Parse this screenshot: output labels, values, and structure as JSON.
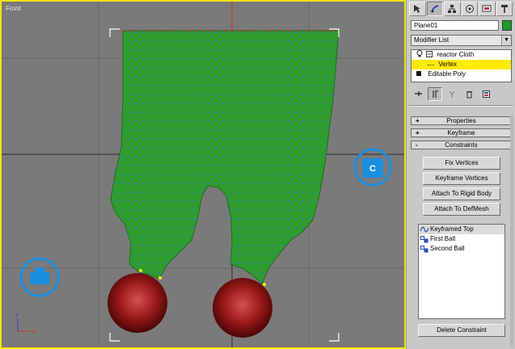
{
  "viewport": {
    "label": "Front",
    "helper_left_label": "",
    "helper_right_label": "C",
    "axis_x_label": "x",
    "axis_z_label": "z"
  },
  "panel": {
    "tabs": [
      {
        "name": "create-tab",
        "icon": "cursor-icon"
      },
      {
        "name": "modify-tab",
        "icon": "modify-icon"
      },
      {
        "name": "hierarchy-tab",
        "icon": "hierarchy-icon"
      },
      {
        "name": "motion-tab",
        "icon": "motion-icon"
      },
      {
        "name": "display-tab",
        "icon": "display-icon"
      },
      {
        "name": "utilities-tab",
        "icon": "hammer-icon"
      }
    ],
    "object_name": "Plane01",
    "object_color": "#1e9a2a",
    "modifier_list_label": "Modifier List",
    "stack": [
      {
        "label": "reactor Cloth",
        "icon": "bulb-icon",
        "expand": "minus"
      },
      {
        "label": "Vertex",
        "selected": true
      },
      {
        "label": "Editable Poly",
        "icon": "black-square-icon"
      }
    ],
    "rollouts": [
      {
        "sign": "+",
        "label": "Properties"
      },
      {
        "sign": "+",
        "label": "Keyframe"
      },
      {
        "sign": "-",
        "label": "Constraints"
      }
    ],
    "buttons": {
      "fix_vertices": "Fix Vertices",
      "keyframe_vertices": "Keyframe Vertices",
      "attach_rigid": "Attach To Rigid Body",
      "attach_defmesh": "Attach To DefMesh",
      "delete_constraint": "Delete Constraint"
    },
    "constraints": [
      {
        "label": "Keyframed Top",
        "icon": "wave-icon",
        "selected": true
      },
      {
        "label": "First Ball",
        "icon": "link-icon"
      },
      {
        "label": "Second Ball",
        "icon": "link-icon"
      }
    ]
  },
  "colors": {
    "viewport_bg": "#7a7a7a",
    "viewport_border": "#f2e600",
    "cloth": "#2f9c2f",
    "cloth_vertex": "#4a6be0",
    "ball": "#8e1414",
    "helper_blue": "#1a8fe0",
    "selection_yellow": "#ffea00"
  }
}
